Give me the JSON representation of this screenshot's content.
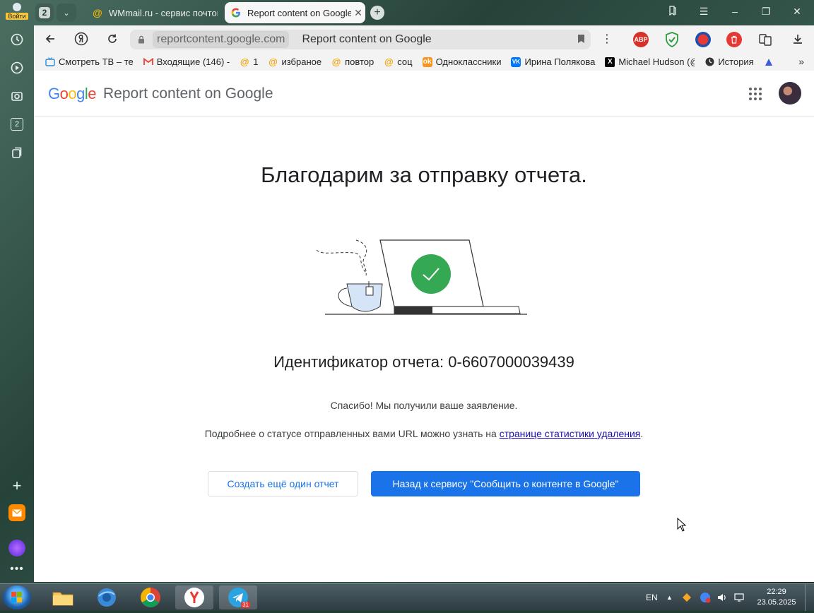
{
  "sidebar": {
    "login_label": "Войти",
    "badge_count": "2"
  },
  "tabs": {
    "count": "2",
    "items": [
      {
        "title": "WMmail.ru - сервис почтовых рассылок",
        "active": false
      },
      {
        "title": "Report content on Google",
        "active": true
      }
    ]
  },
  "address_bar": {
    "domain": "reportcontent.google.com",
    "page_title": "Report content on Google"
  },
  "extensions": [
    "ABP"
  ],
  "bookmarks": [
    {
      "label": "Смотреть ТВ – те",
      "icon": "tv-icon"
    },
    {
      "label": "Входящие (146) -",
      "icon": "gmail-icon"
    },
    {
      "label": "1",
      "icon": "wmmail-icon"
    },
    {
      "label": "избраное",
      "icon": "wmmail-icon"
    },
    {
      "label": "повтор",
      "icon": "wmmail-icon"
    },
    {
      "label": "соц",
      "icon": "wmmail-icon"
    },
    {
      "label": "Одноклассники",
      "icon": "ok-icon"
    },
    {
      "label": "Ирина Полякова",
      "icon": "vk-icon"
    },
    {
      "label": "Michael Hudson (@",
      "icon": "x-icon"
    },
    {
      "label": "История",
      "icon": "history-icon"
    }
  ],
  "header": {
    "logo": "Google",
    "title": "Report content on Google"
  },
  "content": {
    "heading": "Благодарим за отправку отчета.",
    "report_id": "Идентификатор отчета: 0-6607000039439",
    "thanks": "Спасибо! Мы получили ваше заявление.",
    "status_text": "Подробнее о статусе отправленных вами URL можно узнать на ",
    "status_link": "странице статистики удаления",
    "status_end": "."
  },
  "buttons": {
    "another_report": "Создать ещё один отчет",
    "back": "Назад к сервису \"Сообщить о контенте в Google\""
  },
  "taskbar": {
    "telegram_badge": "31",
    "language": "EN",
    "time": "22:29",
    "date": "23.05.2025"
  },
  "colors": {
    "google_blue": "#4285F4",
    "google_red": "#EA4335",
    "google_yellow": "#FBBC05",
    "google_green": "#34A853",
    "primary_button": "#1a73e8",
    "check_circle": "#34a853"
  }
}
